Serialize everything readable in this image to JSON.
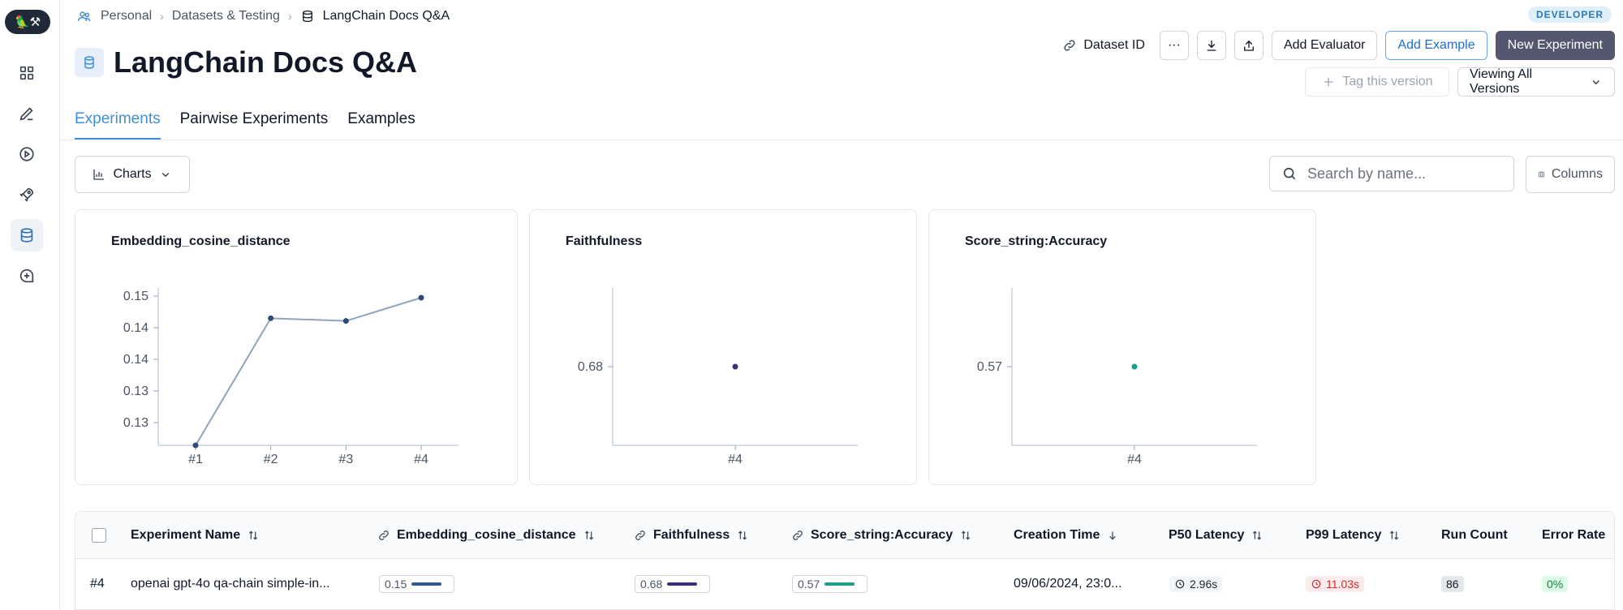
{
  "app": {
    "logo_text": "🦜⚒",
    "role_badge": "DEVELOPER"
  },
  "breadcrumb": {
    "items": [
      "Personal",
      "Datasets & Testing",
      "LangChain Docs Q&A"
    ]
  },
  "page": {
    "title": "LangChain Docs Q&A"
  },
  "toolbar": {
    "dataset_id_label": "Dataset ID",
    "more_label": "···",
    "add_evaluator_label": "Add Evaluator",
    "add_example_label": "Add Example",
    "new_experiment_label": "New Experiment",
    "tag_version_label": "Tag this version",
    "viewing_versions_label": "Viewing All Versions"
  },
  "tabs": [
    {
      "label": "Experiments",
      "active": true
    },
    {
      "label": "Pairwise Experiments",
      "active": false
    },
    {
      "label": "Examples",
      "active": false
    }
  ],
  "controls": {
    "charts_label": "Charts",
    "search_placeholder": "Search by name...",
    "columns_label": "Columns"
  },
  "chart_data": [
    {
      "type": "line",
      "title": "Embedding_cosine_distance",
      "x": [
        "#1",
        "#2",
        "#3",
        "#4"
      ],
      "values": [
        0.123,
        0.1465,
        0.146,
        0.1503
      ],
      "yticks": [
        "0.15",
        "0.14",
        "0.14",
        "0.13",
        "0.13"
      ],
      "color": "#8fa3bd",
      "point_color": "#2e4a78"
    },
    {
      "type": "scatter",
      "title": "Faithfulness",
      "x": [
        "#4"
      ],
      "values": [
        0.68
      ],
      "yticks": [
        "0.68"
      ],
      "point_color": "#3b2f7a"
    },
    {
      "type": "scatter",
      "title": "Score_string:Accuracy",
      "x": [
        "#4"
      ],
      "values": [
        0.57
      ],
      "yticks": [
        "0.57"
      ],
      "point_color": "#1aa08a"
    }
  ],
  "table": {
    "columns": [
      "Experiment Name",
      "Embedding_cosine_distance",
      "Faithfulness",
      "Score_string:Accuracy",
      "Creation Time",
      "P50 Latency",
      "P99 Latency",
      "Run Count",
      "Error Rate"
    ],
    "rows": [
      {
        "index": "#4",
        "name": "openai gpt-4o qa-chain simple-in...",
        "embedding": "0.15",
        "embedding_fraction": 0.8,
        "faithfulness": "0.68",
        "faithfulness_fraction": 0.8,
        "accuracy": "0.57",
        "accuracy_fraction": 0.8,
        "creation_time": "09/06/2024, 23:0...",
        "p50": "2.96s",
        "p99": "11.03s",
        "run_count": "86",
        "error_rate": "0%"
      }
    ]
  },
  "colors": {
    "accent": "#3f8fd9",
    "embedding_bar": "#2e5c8f",
    "faithfulness_bar": "#3b2f7a",
    "accuracy_bar": "#1aa08a"
  }
}
